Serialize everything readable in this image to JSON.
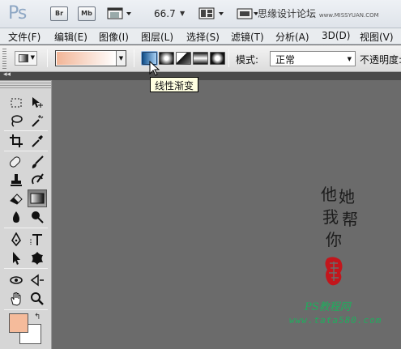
{
  "app": {
    "logo": "Ps",
    "bridge_label": "Br",
    "minibridge_label": "Mb",
    "zoom": "66.7",
    "site_text": "思缘设计论坛",
    "site_url": "www.MISSYUAN.COM"
  },
  "menu": [
    "文件(F)",
    "编辑(E)",
    "图像(I)",
    "图层(L)",
    "选择(S)",
    "滤镜(T)",
    "分析(A)",
    "3D(D)",
    "视图(V)"
  ],
  "options": {
    "gradient_colors": [
      "#f2b597",
      "#ffffff"
    ],
    "gradient_types": [
      "linear",
      "radial",
      "angle",
      "reflected",
      "diamond"
    ],
    "mode_label": "模式:",
    "mode_value": "正常",
    "opacity_label": "不透明度:"
  },
  "tooltip": "线性渐变",
  "colors": {
    "foreground": "#f5bb9b",
    "background": "#ffffff",
    "canvas": "#6b6b6b",
    "watermark_green": "#1fae5e"
  },
  "tools": [
    "rect-marquee",
    "move",
    "lasso",
    "magic-wand",
    "crop",
    "eyedropper",
    "spot-heal",
    "brush",
    "clone-stamp",
    "history-brush",
    "eraser",
    "gradient",
    "blur",
    "dodge",
    "pen",
    "type",
    "path-select",
    "custom-shape",
    "3d-rotate",
    "3d-orbit",
    "hand",
    "zoom"
  ],
  "watermark": {
    "calligraphy": [
      "他",
      "她",
      "我",
      "帮",
      "你"
    ],
    "site_name": "PS教程网",
    "site_url": "www.tata580.com"
  }
}
